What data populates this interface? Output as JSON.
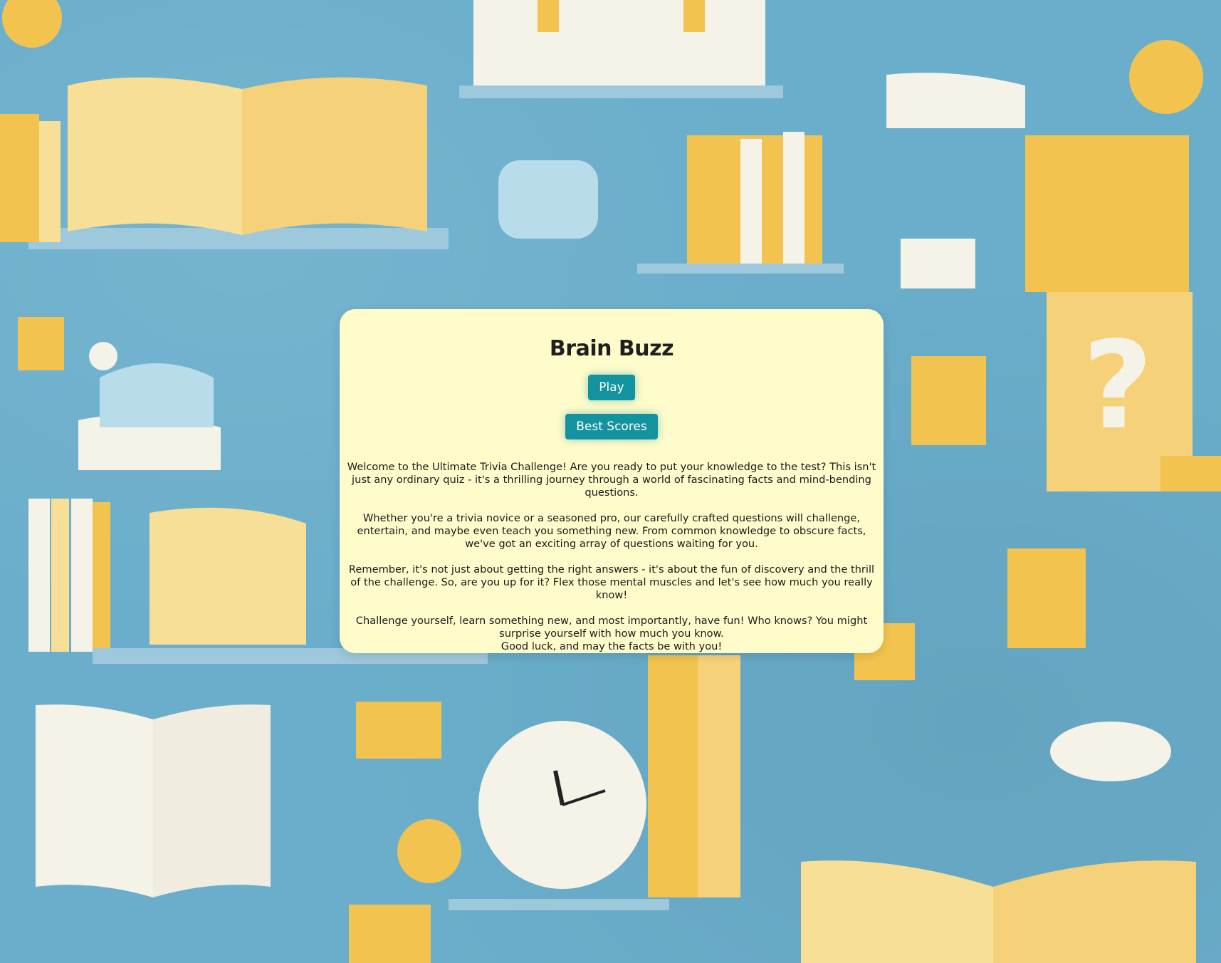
{
  "background": {
    "description_colors": {
      "sky": "#6aaecb",
      "book_yellow": "#f2c44f",
      "book_light": "#f8df98",
      "paper": "#f5f2e8",
      "light_blue": "#b9dceb"
    }
  },
  "card": {
    "title": "Brain Buzz",
    "play_label": "Play",
    "best_scores_label": "Best Scores",
    "paragraphs": [
      "Welcome to the Ultimate Trivia Challenge! Are you ready to put your knowledge to the test? This isn't just any ordinary quiz - it's a thrilling journey through a world of fascinating facts and mind-bending questions.",
      "Whether you're a trivia novice or a seasoned pro, our carefully crafted questions will challenge, entertain, and maybe even teach you something new. From common knowledge to obscure facts, we've got an exciting array of questions waiting for you.",
      "Remember, it's not just about getting the right answers - it's about the fun of discovery and the thrill of the challenge. So, are you up for it? Flex those mental muscles and let's see how much you really know!",
      "Challenge yourself, learn something new, and most importantly, have fun! Who knows? You might surprise yourself with how much you know."
    ],
    "closing_line": "Good luck, and may the facts be with you!"
  },
  "colors": {
    "card_bg": "#fffccb",
    "button_bg": "#13939f",
    "button_text": "#ffffff",
    "title_text": "#1f1f1f"
  }
}
